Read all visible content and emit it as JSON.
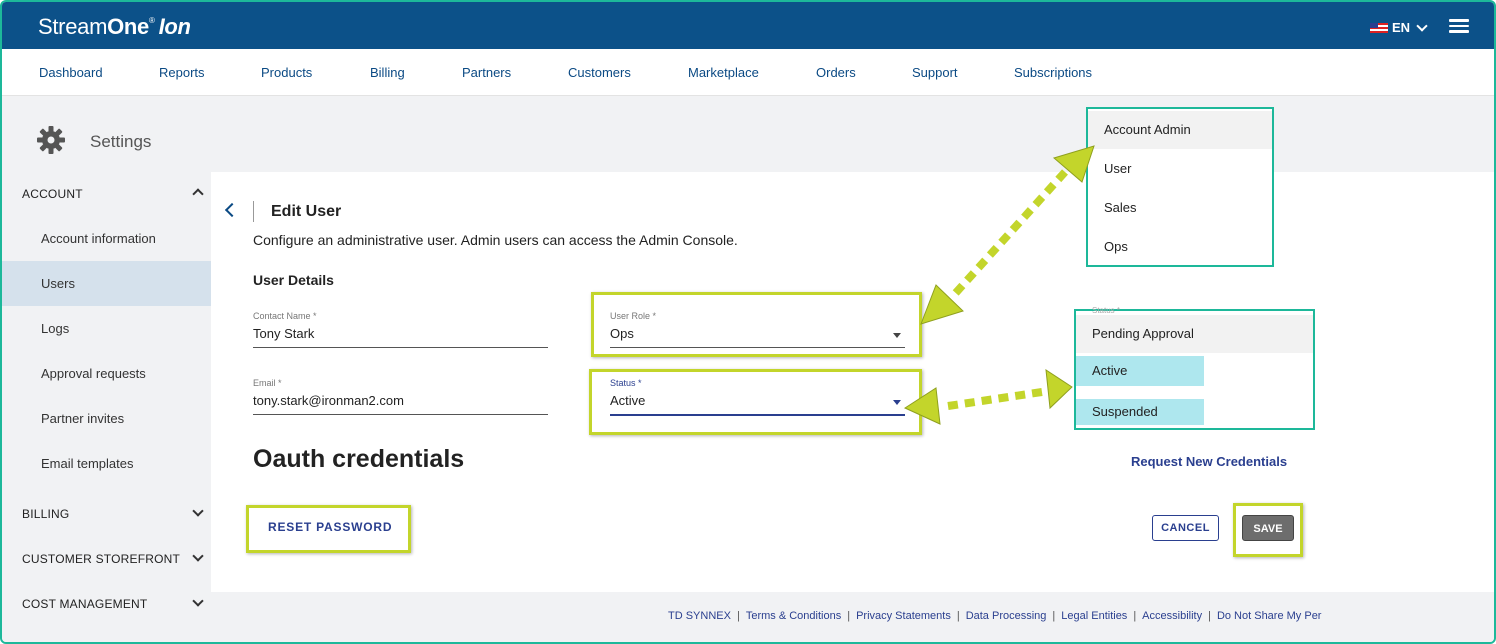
{
  "header": {
    "logo_main": "Stream",
    "logo_bold": "One",
    "logo_reg": "®",
    "logo_italic": "Ion",
    "language": "EN",
    "brand_color": "#0c5189"
  },
  "nav": {
    "items": [
      "Dashboard",
      "Reports",
      "Products",
      "Billing",
      "Partners",
      "Customers",
      "Marketplace",
      "Orders",
      "Support",
      "Subscriptions"
    ]
  },
  "settings": {
    "title": "Settings"
  },
  "sidebar": {
    "account_label": "ACCOUNT",
    "items": [
      "Account information",
      "Users",
      "Logs",
      "Approval requests",
      "Partner invites",
      "Email templates"
    ],
    "active_item": "Users",
    "billing_label": "BILLING",
    "storefront_label": "CUSTOMER STOREFRONT",
    "cost_label": "COST MANAGEMENT"
  },
  "page": {
    "title": "Edit User",
    "subtitle": "Configure an administrative user. Admin users can access the Admin Console.",
    "section": "User Details",
    "contact_label": "Contact Name *",
    "contact_value": "Tony Stark",
    "email_label": "Email *",
    "email_value": "tony.stark@ironman2.com",
    "role_label": "User Role *",
    "role_value": "Ops",
    "status_label": "Status *",
    "status_value": "Active",
    "oauth_title": "Oauth credentials",
    "request_link": "Request New Credentials",
    "reset_label": "RESET PASSWORD",
    "cancel_label": "CANCEL",
    "save_label": "SAVE"
  },
  "role_dropdown": {
    "options": [
      "Account Admin",
      "User",
      "Sales",
      "Ops"
    ]
  },
  "status_dropdown": {
    "peek_label": "Status *",
    "options": [
      "Pending Approval",
      "Active",
      "Suspended"
    ]
  },
  "footer": {
    "links": [
      "TD SYNNEX",
      "Terms & Conditions",
      "Privacy Statements",
      "Data Processing",
      "Legal Entities",
      "Accessibility",
      "Do Not Share My Per"
    ]
  },
  "colors": {
    "annotation": "#c3d52b",
    "dropdown_border": "#1db89a",
    "option_highlight": "#aee7ee",
    "link": "#2a3f8f"
  }
}
